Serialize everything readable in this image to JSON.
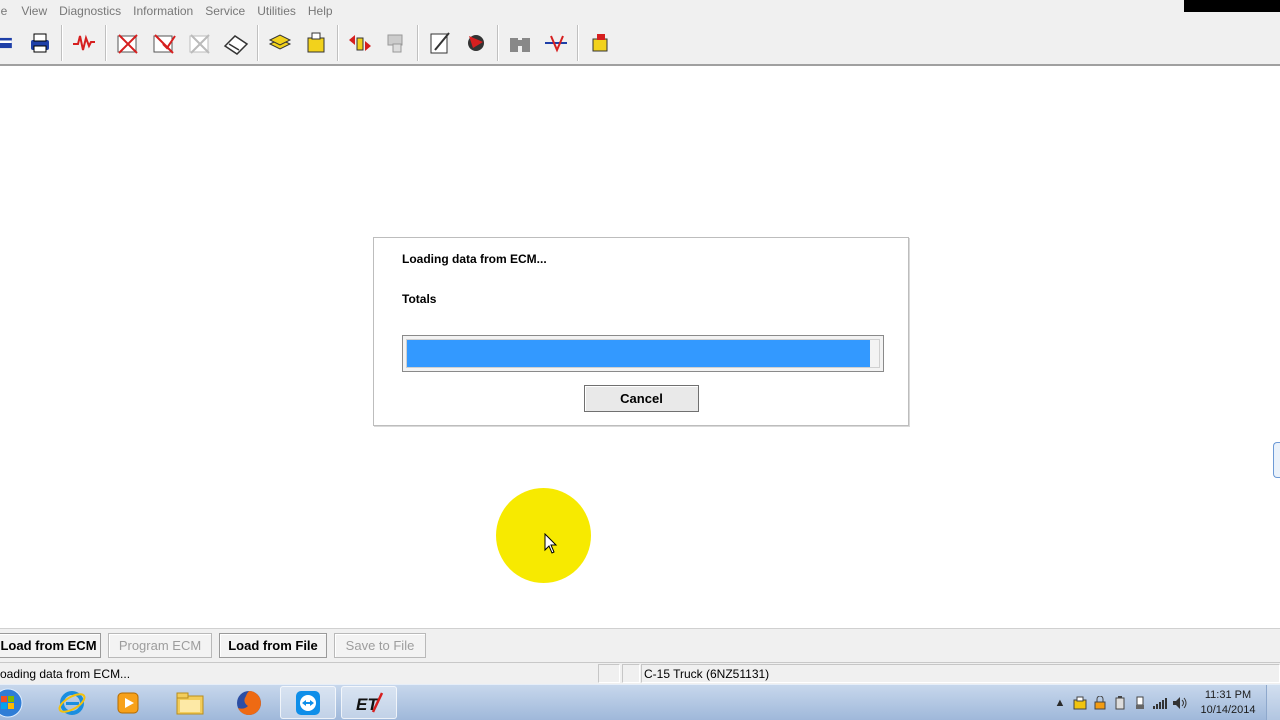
{
  "menu": {
    "items": [
      "le",
      "View",
      "Diagnostics",
      "Information",
      "Service",
      "Utilities",
      "Help"
    ]
  },
  "toolbar": {
    "icons": [
      "ecm-summary-icon",
      "print-icon",
      "status-graph-icon",
      "diagnostic-codes-icon",
      "event-codes-icon",
      "clear-codes-icon",
      "logged-codes-icon",
      "calibrations-icon",
      "tests-icon",
      "connect-icon",
      "disconnect-icon",
      "config-icon",
      "tools-icon",
      "binoculars-icon",
      "switch-icon",
      "flash-icon"
    ]
  },
  "dialog": {
    "title": "Loading data from ECM...",
    "subtitle": "Totals",
    "progress_percent": 98,
    "progress_color": "#3399ff",
    "cancel_label": "Cancel"
  },
  "buttons": {
    "load_from_ecm": "Load from ECM",
    "program_ecm": "Program ECM",
    "load_from_file": "Load from File",
    "save_to_file": "Save to File"
  },
  "status": {
    "message": "oading data from ECM...",
    "ecm_info": "C-15 Truck (6NZ51131)"
  },
  "taskbar": {
    "apps": [
      "windows-start-icon",
      "internet-explorer-icon",
      "media-player-icon",
      "file-explorer-icon",
      "firefox-icon",
      "teamviewer-icon",
      "electronic-technician-icon"
    ]
  },
  "tray": {
    "time": "11:31 PM",
    "date": "10/14/2014",
    "expand_glyph": "▲"
  }
}
